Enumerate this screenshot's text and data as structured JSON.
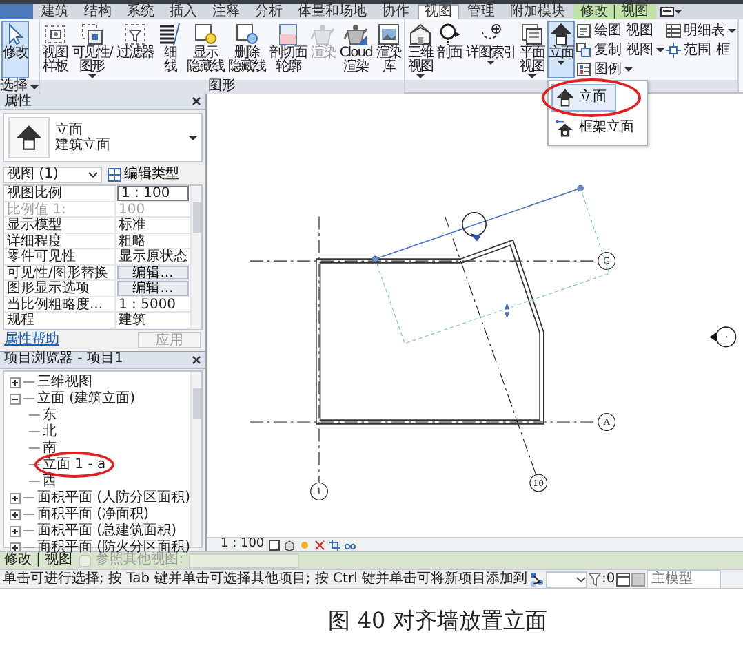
{
  "tabs": [
    {
      "label": "建筑",
      "selected": false,
      "kind": "normal"
    },
    {
      "label": "结构",
      "selected": false,
      "kind": "normal"
    },
    {
      "label": "系统",
      "selected": false,
      "kind": "normal"
    },
    {
      "label": "插入",
      "selected": false,
      "kind": "normal"
    },
    {
      "label": "注释",
      "selected": false,
      "kind": "normal"
    },
    {
      "label": "分析",
      "selected": false,
      "kind": "normal"
    },
    {
      "label": "体量和场地",
      "selected": false,
      "kind": "normal"
    },
    {
      "label": "协作",
      "selected": false,
      "kind": "normal"
    },
    {
      "label": "视图",
      "selected": true,
      "kind": "normal"
    },
    {
      "label": "管理",
      "selected": false,
      "kind": "normal"
    },
    {
      "label": "附加模块",
      "selected": false,
      "kind": "normal"
    },
    {
      "label": "修改 | 视图",
      "selected": false,
      "kind": "contextual"
    }
  ],
  "ribbon": {
    "panels": [
      {
        "title": "选择",
        "dropdown": true,
        "items": [
          {
            "kind": "large",
            "lines": [
              "修改"
            ],
            "selected": true,
            "disabled": false,
            "dropdown": false
          }
        ]
      },
      {
        "title": "图形",
        "dropdown": false,
        "items": [
          {
            "kind": "large",
            "lines": [
              "视图",
              "样板"
            ],
            "selected": false,
            "disabled": false,
            "dropdown": false
          },
          {
            "kind": "large",
            "lines": [
              "可见性/",
              "图形"
            ],
            "selected": false,
            "disabled": false,
            "dropdown": true
          },
          {
            "kind": "large",
            "lines": [
              "过滤器"
            ],
            "selected": false,
            "disabled": false,
            "dropdown": false
          },
          {
            "kind": "large",
            "lines": [
              "细",
              "线"
            ],
            "selected": false,
            "disabled": false,
            "dropdown": false
          },
          {
            "kind": "large",
            "lines": [
              "显示",
              "隐藏线"
            ],
            "selected": false,
            "disabled": false,
            "dropdown": false
          },
          {
            "kind": "large",
            "lines": [
              "删除",
              "隐藏线"
            ],
            "selected": false,
            "disabled": false,
            "dropdown": false
          },
          {
            "kind": "large",
            "lines": [
              "剖切面",
              "轮廓"
            ],
            "selected": false,
            "disabled": false,
            "dropdown": false
          },
          {
            "kind": "large",
            "lines": [
              "渲染"
            ],
            "selected": false,
            "disabled": true,
            "dropdown": false
          },
          {
            "kind": "large",
            "lines": [
              "Cloud",
              "渲染"
            ],
            "selected": false,
            "disabled": false,
            "dropdown": false
          },
          {
            "kind": "large",
            "lines": [
              "渲染",
              "库"
            ],
            "selected": false,
            "disabled": false,
            "dropdown": false
          }
        ]
      },
      {
        "dropdown": false,
        "items": [
          {
            "kind": "large",
            "lines": [
              "三维",
              "视图"
            ],
            "selected": false,
            "disabled": false,
            "dropdown": true
          },
          {
            "kind": "large",
            "lines": [
              "剖面"
            ],
            "selected": false,
            "disabled": false,
            "dropdown": false
          },
          {
            "kind": "large",
            "lines": [
              "详图索引"
            ],
            "selected": false,
            "disabled": false,
            "dropdown": true
          },
          {
            "kind": "large",
            "lines": [
              "平面",
              "视图"
            ],
            "selected": false,
            "disabled": false,
            "dropdown": true
          },
          {
            "kind": "large",
            "lines": [
              "立面"
            ],
            "selected": true,
            "disabled": false,
            "dropdown": true,
            "menu": [
              {
                "label": "立面",
                "selected": true,
                "circled": true
              },
              {
                "label": "框架立面",
                "selected": false,
                "circled": false
              }
            ]
          },
          {
            "kind": "stack",
            "entries": [
              {
                "label": "绘图 视图",
                "dropdown": false
              },
              {
                "label": "复制 视图",
                "dropdown": true
              },
              {
                "label": "图例",
                "dropdown": true
              }
            ]
          },
          {
            "kind": "stack",
            "entries": [
              {
                "label": "明细表",
                "dropdown": true
              },
              {
                "label": "范围 框",
                "dropdown": false
              }
            ]
          }
        ]
      }
    ]
  },
  "properties": {
    "title": "属性",
    "type_name": "立面",
    "type_family": "建筑立面",
    "view_selector": "视图 (1)",
    "edit_type": "编辑类型",
    "rows": [
      {
        "name": "视图比例",
        "value": "1 : 100",
        "kind": "field",
        "disabled": false
      },
      {
        "name": "比例值 1:",
        "value": "100",
        "kind": "text",
        "disabled": true
      },
      {
        "name": "显示模型",
        "value": "标准",
        "kind": "text",
        "disabled": false
      },
      {
        "name": "详细程度",
        "value": "粗略",
        "kind": "text",
        "disabled": false
      },
      {
        "name": "零件可见性",
        "value": "显示原状态",
        "kind": "text",
        "disabled": false
      },
      {
        "name": "可见性/图形替换",
        "value": "编辑...",
        "kind": "button",
        "disabled": false
      },
      {
        "name": "图形显示选项",
        "value": "编辑...",
        "kind": "button",
        "disabled": false
      },
      {
        "name": "当比例粗略度...",
        "value": "1 : 5000",
        "kind": "text",
        "disabled": false
      },
      {
        "name": "规程",
        "value": "建筑",
        "kind": "text",
        "disabled": false
      }
    ],
    "help": "属性帮助",
    "apply": "应用"
  },
  "browser": {
    "title": "项目浏览器 - 项目1",
    "tree": [
      {
        "label": "三维视图",
        "expanded": false
      },
      {
        "label": "立面 (建筑立面)",
        "expanded": true,
        "children": [
          {
            "label": "东",
            "circled": false
          },
          {
            "label": "北",
            "circled": false
          },
          {
            "label": "南",
            "circled": false
          },
          {
            "label": "立面 1 - a",
            "circled": true
          },
          {
            "label": "西",
            "circled": false
          }
        ]
      },
      {
        "label": "面积平面 (人防分区面积)",
        "expanded": false
      },
      {
        "label": "面积平面 (净面积)",
        "expanded": false
      },
      {
        "label": "面积平面 (总建筑面积)",
        "expanded": false
      },
      {
        "label": "面积平面 (防火分区面积)",
        "expanded": false
      }
    ]
  },
  "canvas": {
    "grids": [
      {
        "label": "G"
      },
      {
        "label": "A"
      },
      {
        "label": "1"
      },
      {
        "label": "10"
      }
    ]
  },
  "view_bar": {
    "scale": "1 : 100"
  },
  "options_bar": {
    "context": "修改 | 视图",
    "reference": {
      "label": "参照其他视图:",
      "checked": false,
      "disabled": true
    }
  },
  "status_bar": {
    "message": "单击可进行选择; 按 Tab 键并单击可选择其他项目; 按 Ctrl 键并单击可将新项目添加到",
    "count": ":0",
    "model_placeholder": "主模型"
  },
  "caption": "图 40 对齐墙放置立面"
}
